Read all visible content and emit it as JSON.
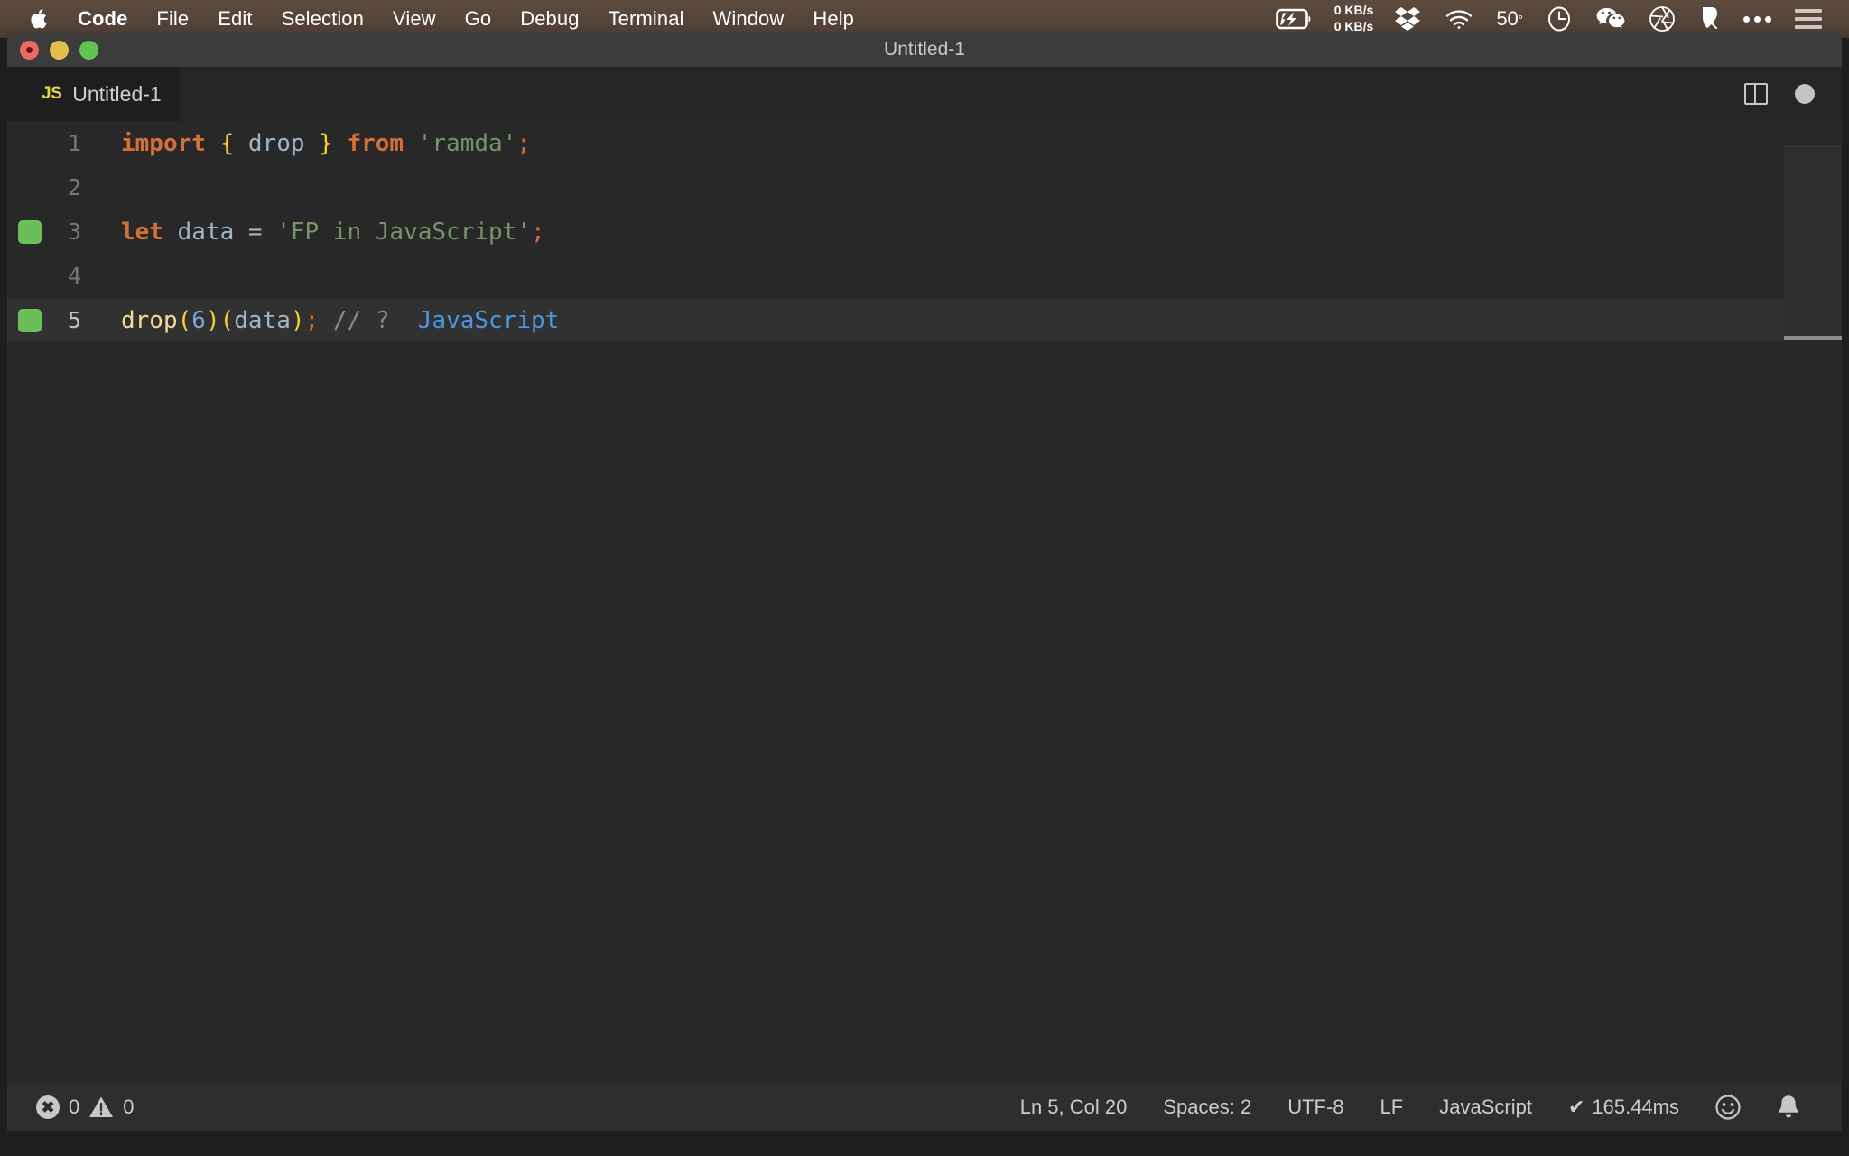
{
  "menubar": {
    "apple_icon": "apple-logo",
    "items": [
      {
        "label": "Code",
        "bold": true
      },
      {
        "label": "File",
        "bold": false
      },
      {
        "label": "Edit",
        "bold": false
      },
      {
        "label": "Selection",
        "bold": false
      },
      {
        "label": "View",
        "bold": false
      },
      {
        "label": "Go",
        "bold": false
      },
      {
        "label": "Debug",
        "bold": false
      },
      {
        "label": "Terminal",
        "bold": false
      },
      {
        "label": "Window",
        "bold": false
      },
      {
        "label": "Help",
        "bold": false
      }
    ],
    "status": {
      "battery_icon": "battery-charging-icon",
      "network_up": "0 KB/s",
      "network_down": "0 KB/s",
      "dropbox_icon": "dropbox-icon",
      "wifi_icon": "wifi-icon",
      "temperature": "50",
      "temperature_unit": "°",
      "clock_icon": "clock-icon",
      "wechat_icon": "wechat-icon",
      "aperture_icon": "aperture-icon",
      "bartender_icon": "bartender-icon",
      "overflow_icon": "ellipsis-icon",
      "list_icon": "list-menu-icon"
    }
  },
  "window": {
    "title": "Untitled-1",
    "traffic_lights": [
      "close",
      "minimize",
      "maximize"
    ]
  },
  "tab": {
    "file_type_badge": "JS",
    "label": "Untitled-1",
    "split_editor_icon": "split-editor-icon",
    "unsaved_indicator": "unsaved-dot-icon"
  },
  "editor": {
    "lines": [
      {
        "number": "1",
        "marker": false,
        "active": false,
        "tokens": [
          {
            "t": "import",
            "c": "k"
          },
          {
            "t": " ",
            "c": "id"
          },
          {
            "t": "{",
            "c": "br"
          },
          {
            "t": " drop ",
            "c": "id"
          },
          {
            "t": "}",
            "c": "br"
          },
          {
            "t": " ",
            "c": "id"
          },
          {
            "t": "from",
            "c": "k"
          },
          {
            "t": " ",
            "c": "id"
          },
          {
            "t": "'ramda'",
            "c": "str"
          },
          {
            "t": ";",
            "c": "pn"
          }
        ]
      },
      {
        "number": "2",
        "marker": false,
        "active": false,
        "tokens": []
      },
      {
        "number": "3",
        "marker": true,
        "active": false,
        "tokens": [
          {
            "t": "let",
            "c": "k"
          },
          {
            "t": " data ",
            "c": "id"
          },
          {
            "t": "=",
            "c": "eq"
          },
          {
            "t": " ",
            "c": "id"
          },
          {
            "t": "'FP in JavaScript'",
            "c": "str"
          },
          {
            "t": ";",
            "c": "pn"
          }
        ]
      },
      {
        "number": "4",
        "marker": false,
        "active": false,
        "tokens": []
      },
      {
        "number": "5",
        "marker": true,
        "active": true,
        "tokens": [
          {
            "t": "drop",
            "c": "fn"
          },
          {
            "t": "(",
            "c": "br"
          },
          {
            "t": "6",
            "c": "num"
          },
          {
            "t": ")",
            "c": "br"
          },
          {
            "t": "(",
            "c": "br"
          },
          {
            "t": "data",
            "c": "id"
          },
          {
            "t": ")",
            "c": "br"
          },
          {
            "t": ";",
            "c": "pn"
          },
          {
            "t": " ",
            "c": "id"
          },
          {
            "t": "// ?",
            "c": "cm"
          },
          {
            "t": "  ",
            "c": "id"
          },
          {
            "t": "JavaScript",
            "c": "val"
          }
        ]
      }
    ],
    "colors": {
      "background": "#282828",
      "active_line": "#313131",
      "keyword": "#d2703a",
      "brace": "#f2d330",
      "identifier": "#a3b4c4",
      "string": "#74946a",
      "function": "#f5d997",
      "number": "#79a7d4",
      "comment": "#8a8a8a",
      "inline_value": "#4a97e0",
      "execution_marker": "#6bbf59"
    }
  },
  "statusbar": {
    "errors_icon": "error-circle-icon",
    "errors_count": "0",
    "warnings_icon": "warning-triangle-icon",
    "warnings_count": "0",
    "cursor_position": "Ln 5, Col 20",
    "indentation": "Spaces: 2",
    "encoding": "UTF-8",
    "eol": "LF",
    "language": "JavaScript",
    "run_status_icon": "✔",
    "run_time": "165.44ms",
    "feedback_icon": "smiley-icon",
    "notifications_icon": "bell-icon"
  }
}
